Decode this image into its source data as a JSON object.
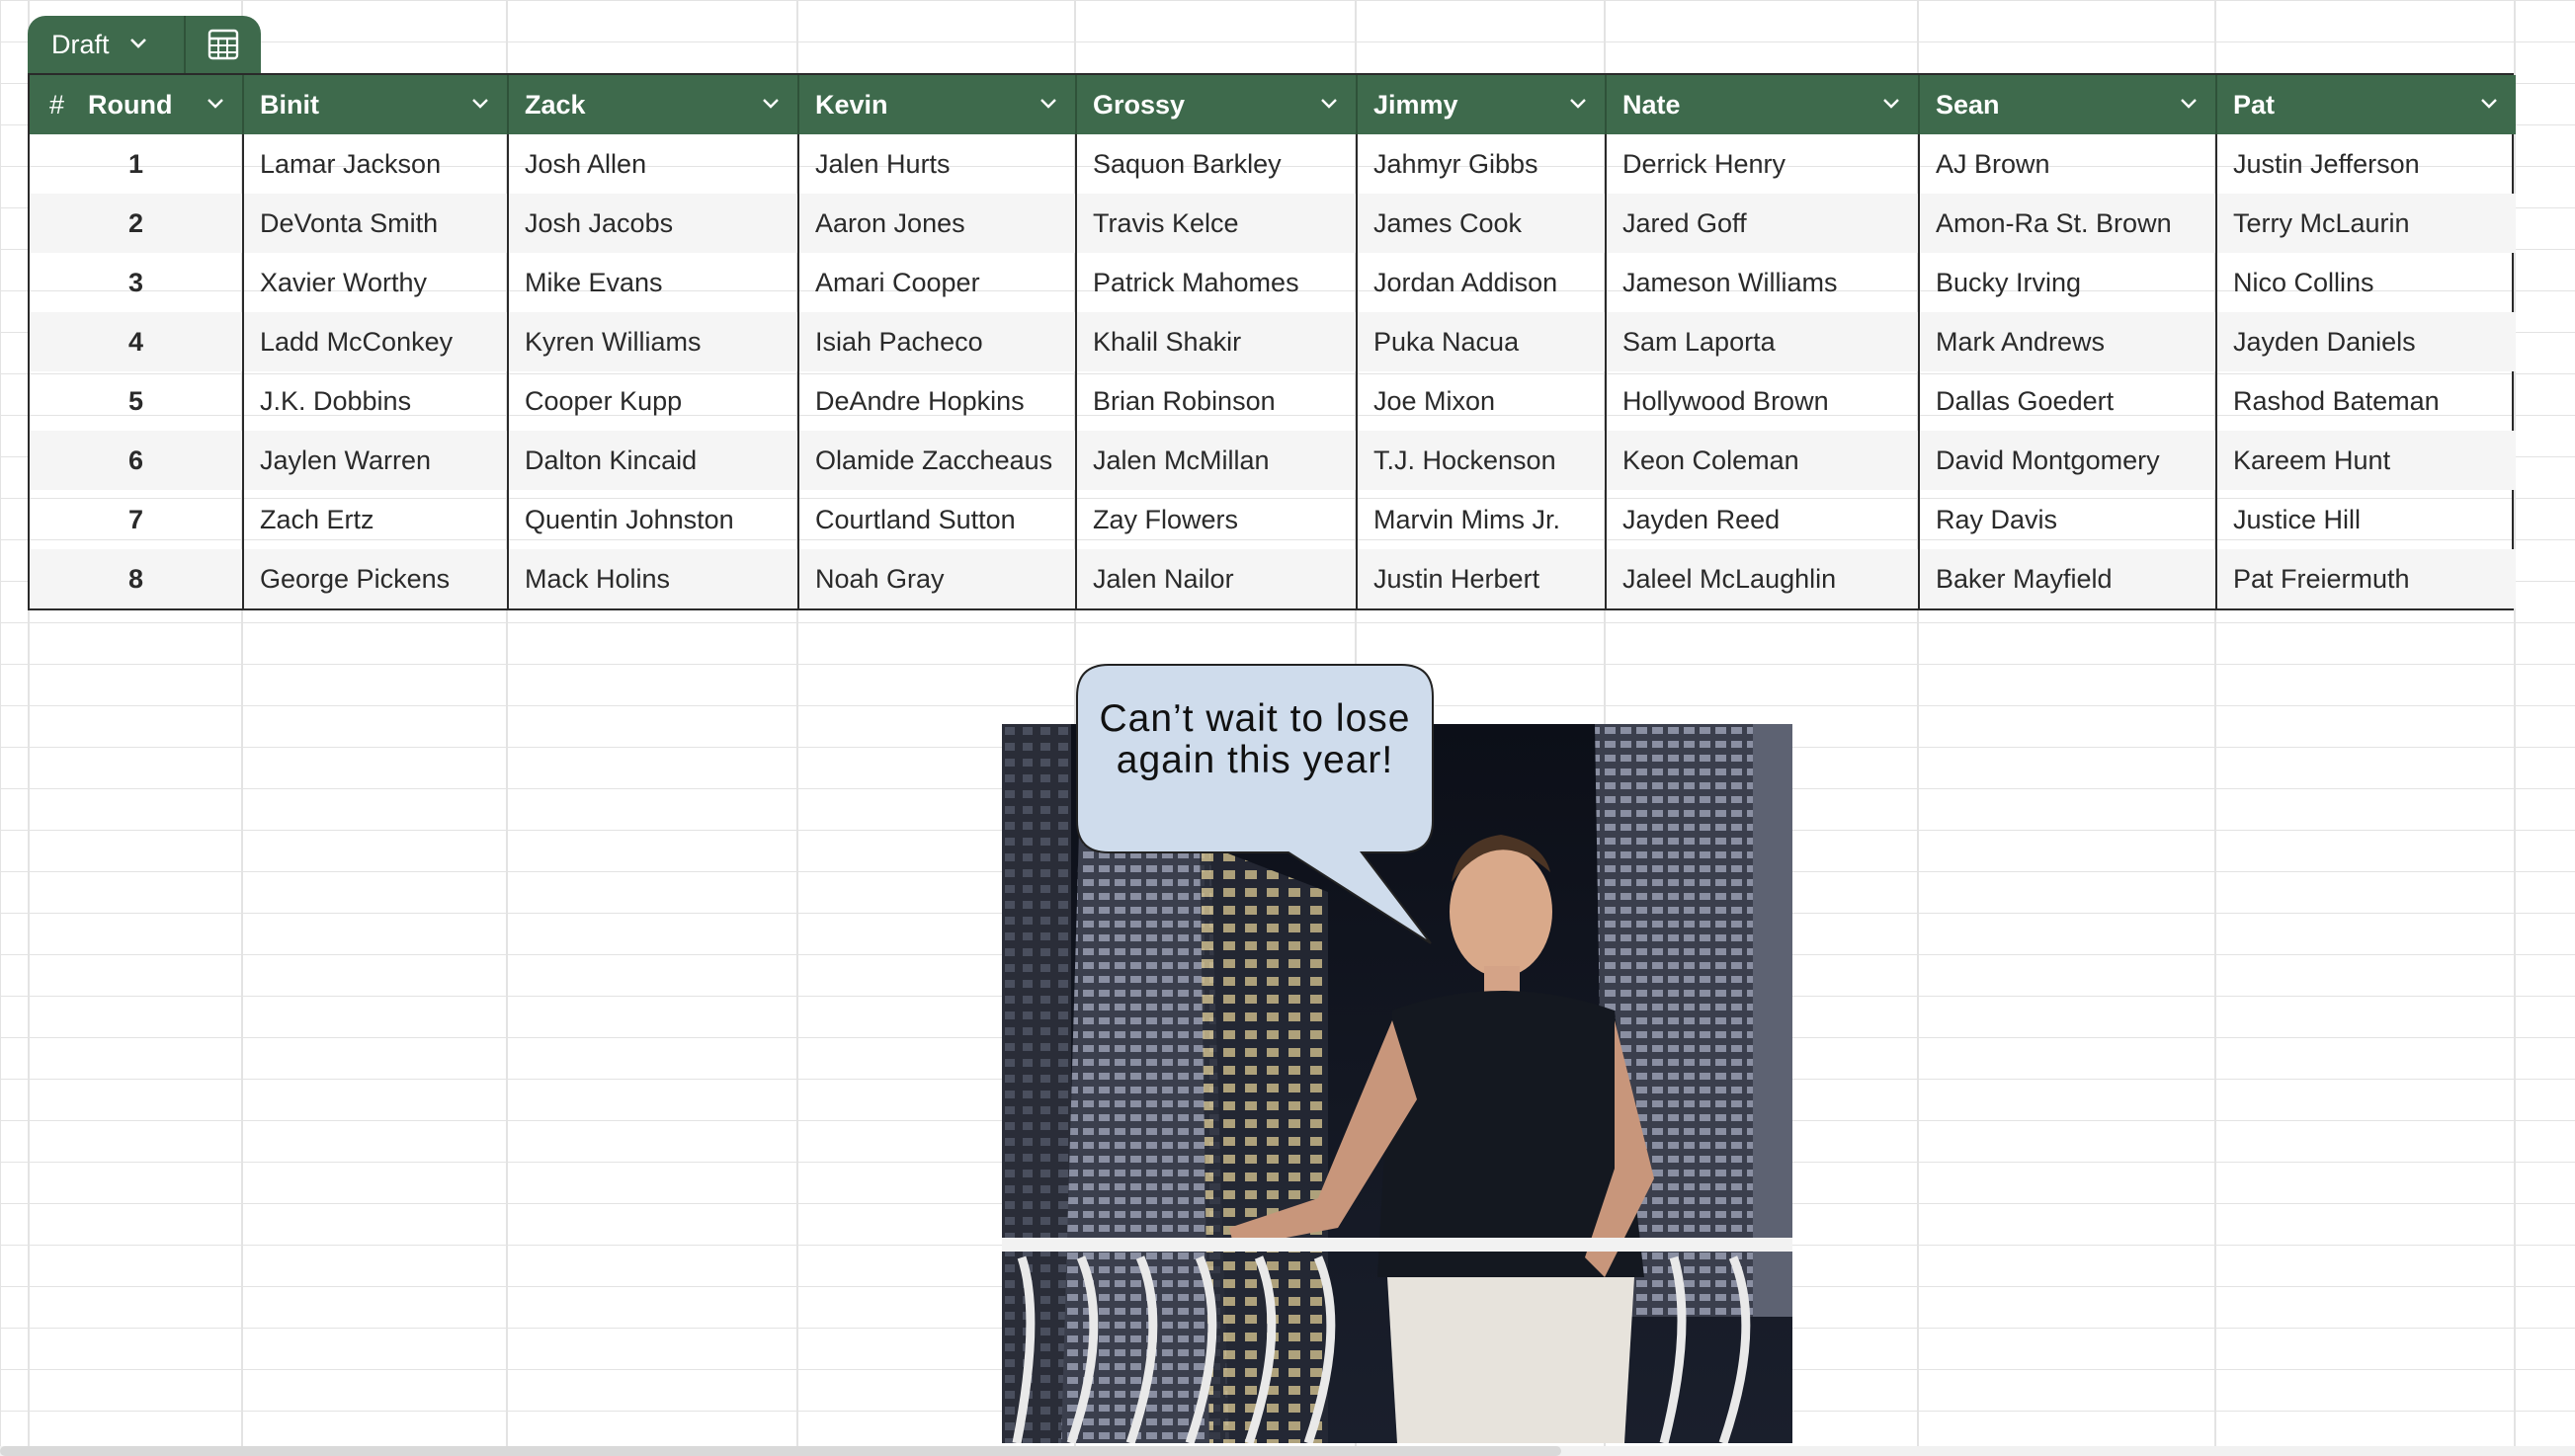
{
  "table_tab": {
    "name": "Draft",
    "chevron_icon": "chevron-down-icon",
    "view_icon": "table-view-icon"
  },
  "draft": {
    "headers": [
      {
        "hash": "#",
        "label": "Round"
      },
      {
        "label": "Binit"
      },
      {
        "label": "Zack"
      },
      {
        "label": "Kevin"
      },
      {
        "label": "Grossy"
      },
      {
        "label": "Jimmy"
      },
      {
        "label": "Nate"
      },
      {
        "label": "Sean"
      },
      {
        "label": "Pat"
      }
    ],
    "rows": [
      [
        "1",
        "Lamar Jackson",
        "Josh Allen",
        "Jalen Hurts",
        "Saquon Barkley",
        "Jahmyr Gibbs",
        "Derrick Henry",
        "AJ Brown",
        "Justin Jefferson"
      ],
      [
        "2",
        "DeVonta Smith",
        "Josh Jacobs",
        "Aaron Jones",
        "Travis Kelce",
        "James Cook",
        "Jared Goff",
        "Amon-Ra St. Brown",
        "Terry McLaurin"
      ],
      [
        "3",
        "Xavier Worthy",
        "Mike Evans",
        "Amari Cooper",
        "Patrick Mahomes",
        "Jordan Addison",
        "Jameson Williams",
        "Bucky Irving",
        "Nico Collins"
      ],
      [
        "4",
        "Ladd McConkey",
        "Kyren Williams",
        "Isiah Pacheco",
        "Khalil Shakir",
        "Puka Nacua",
        "Sam Laporta",
        "Mark Andrews",
        "Jayden Daniels"
      ],
      [
        "5",
        "J.K. Dobbins",
        "Cooper Kupp",
        "DeAndre Hopkins",
        "Brian Robinson",
        "Joe Mixon",
        "Hollywood Brown",
        "Dallas Goedert",
        "Rashod Bateman"
      ],
      [
        "6",
        "Jaylen Warren",
        "Dalton Kincaid",
        "Olamide Zaccheaus",
        "Jalen McMillan",
        "T.J. Hockenson",
        "Keon Coleman",
        "David Montgomery",
        "Kareem Hunt"
      ],
      [
        "7",
        "Zach Ertz",
        "Quentin Johnston",
        "Courtland Sutton",
        "Zay Flowers",
        "Marvin Mims Jr.",
        "Jayden Reed",
        "Ray Davis",
        "Justice Hill"
      ],
      [
        "8",
        "George Pickens",
        "Mack Holins",
        "Noah Gray",
        "Jalen Nailor",
        "Justin Herbert",
        "Jaleel McLaughlin",
        "Baker Mayfield",
        "Pat Freiermuth"
      ]
    ]
  },
  "bubble": {
    "text": "Can’t wait to lose again this year!"
  },
  "colors": {
    "header_green": "#3e6a4c",
    "gridline": "#e3e3e3",
    "bubble_fill": "#cfdcec"
  }
}
